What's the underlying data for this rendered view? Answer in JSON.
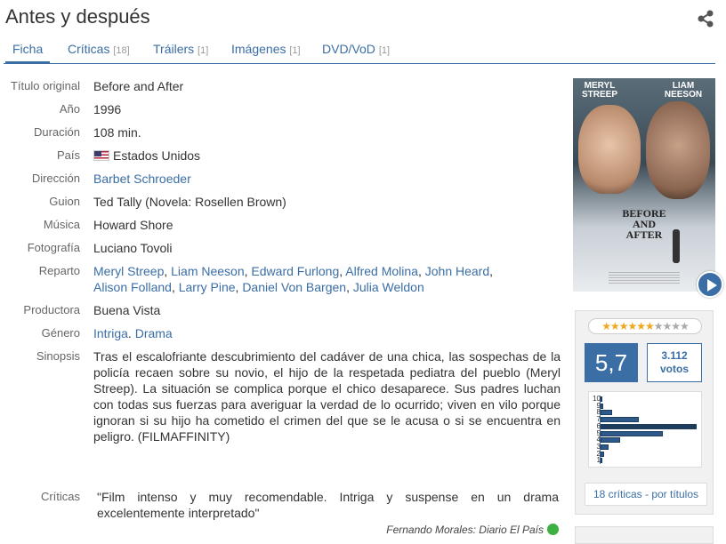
{
  "title": "Antes y después",
  "tabs": [
    {
      "label": "Ficha",
      "count": ""
    },
    {
      "label": "Críticas",
      "count": "[18]"
    },
    {
      "label": "Tráilers",
      "count": "[1]"
    },
    {
      "label": "Imágenes",
      "count": "[1]"
    },
    {
      "label": "DVD/VoD",
      "count": "[1]"
    }
  ],
  "fields": {
    "original_title": {
      "label": "Título original",
      "value": "Before and After"
    },
    "year": {
      "label": "Año",
      "value": "1996"
    },
    "duration": {
      "label": "Duración",
      "value": "108 min."
    },
    "country": {
      "label": "País",
      "value": "Estados Unidos"
    },
    "director": {
      "label": "Dirección",
      "value": "Barbet Schroeder"
    },
    "screenplay": {
      "label": "Guion",
      "value": "Ted Tally (Novela: Rosellen Brown)"
    },
    "music": {
      "label": "Música",
      "value": "Howard Shore"
    },
    "photography": {
      "label": "Fotografía",
      "value": "Luciano Tovoli"
    },
    "cast": {
      "label": "Reparto",
      "values": [
        "Meryl Streep",
        "Liam Neeson",
        "Edward Furlong",
        "Alfred Molina",
        "John Heard",
        "Alison Folland",
        "Larry Pine",
        "Daniel Von Bargen",
        "Julia Weldon"
      ]
    },
    "producer": {
      "label": "Productora",
      "value": "Buena Vista"
    },
    "genre": {
      "label": "Género",
      "values": [
        "Intriga",
        "Drama"
      ]
    },
    "synopsis": {
      "label": "Sinopsis",
      "value": "Tras el escalofriante descubrimiento del cadáver de una chica, las sospechas de la policía recaen sobre su novio, el hijo de la respetada pediatra del pueblo (Meryl Streep). La situación se complica porque el chico desaparece. Sus padres luchan con todas sus fuerzas para averiguar la verdad de lo ocurrido; viven en vilo porque ignoran si su hijo ha cometido el crimen del que se le acusa o si se encuentra en peligro. (FILMAFFINITY)"
    },
    "reviews": {
      "label": "Críticas"
    }
  },
  "review": {
    "quote": "\"Film intenso y muy recomendable. Intriga y suspense en un drama excelentemente interpretado\"",
    "author": "Fernando Morales: Diario El País"
  },
  "poster": {
    "actor1": "MERYL STREEP",
    "actor2": "LIAM NEESON",
    "title": "BEFORE AND AFTER"
  },
  "rating": {
    "average": "5,7",
    "votes_count": "3.112",
    "votes_label": "votos",
    "stars_on": 6,
    "stars_total": 10,
    "histogram_ticks": [
      "10",
      "9",
      "8",
      "7",
      "6",
      "5",
      "4",
      "3",
      "2",
      "1"
    ],
    "histogram_values": [
      1,
      3,
      12,
      40,
      100,
      65,
      20,
      8,
      4,
      2
    ],
    "critics_link": "18 críticas - por títulos"
  },
  "colors": {
    "accent": "#3a6ea5",
    "positive_review": "#3cb043",
    "star": "#f0a820"
  },
  "icons": {
    "share": "share-icon",
    "play": "play-icon"
  }
}
